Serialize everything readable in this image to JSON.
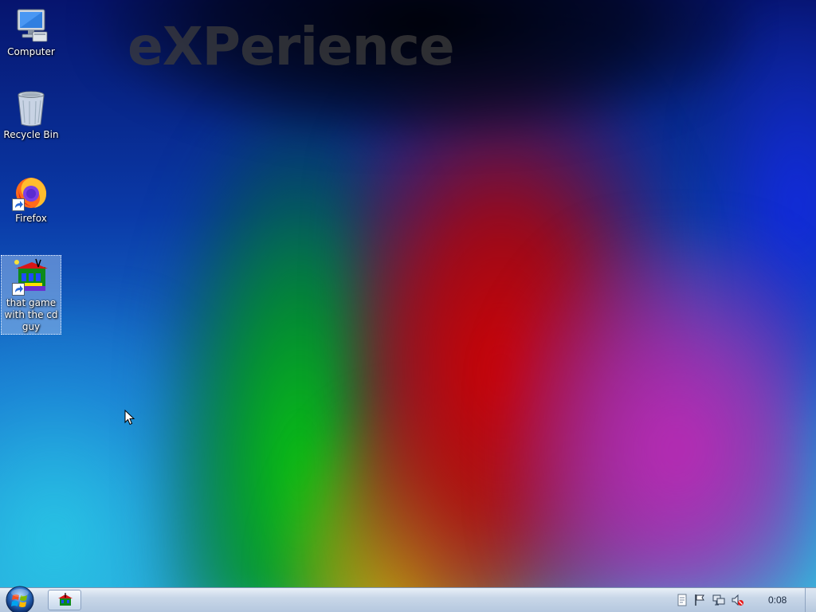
{
  "wallpaper": {
    "watermark_text": "eXPerience",
    "colors": [
      "#0a1a8a",
      "#00c000",
      "#d40000",
      "#c030b0",
      "#30c0e0",
      "#d8c400"
    ]
  },
  "desktop_icons": [
    {
      "label": "Computer",
      "icon": "computer-icon",
      "selected": false
    },
    {
      "label": "Recycle Bin",
      "icon": "recycle-bin-icon",
      "selected": false
    },
    {
      "label": "Firefox",
      "icon": "firefox-icon",
      "shortcut": true,
      "selected": false
    },
    {
      "label": "that game with the cd guy",
      "icon": "game-house-icon",
      "shortcut": true,
      "selected": true
    }
  ],
  "taskbar": {
    "start_icon": "windows-orb-icon",
    "task_buttons": [
      {
        "icon": "game-house-icon"
      }
    ],
    "tray_icons": [
      "notes-icon",
      "action-center-flag-icon",
      "network-icon",
      "volume-muted-icon"
    ],
    "clock": "0:08"
  }
}
